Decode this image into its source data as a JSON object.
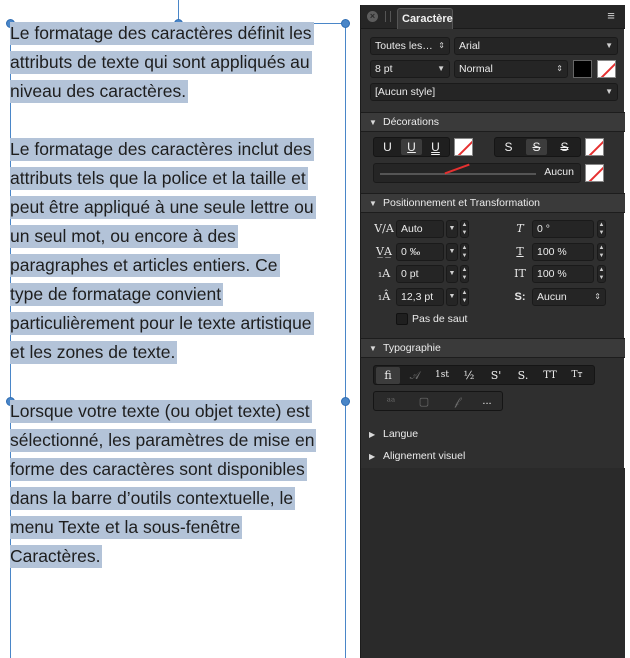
{
  "text_frame": {
    "paragraphs": [
      [
        "Le formatage des caractères définit les",
        "attributs de texte qui sont appliqués au",
        "niveau des caractères."
      ],
      [
        "Le formatage des caractères inclut des",
        "attributs tels que la police et la taille et",
        "peut être appliqué à une seule lettre ou",
        "un seul mot, ou encore à des",
        "paragraphes et articles entiers. Ce",
        "type de formatage convient",
        "particulièrement pour le texte artistique",
        "et les zones de texte."
      ],
      [
        "Lorsque votre texte (ou objet texte) est",
        "sélectionné, les paramètres de mise en",
        "forme des caractères sont disponibles",
        "dans la barre d’outils contextuelle, le",
        "menu Texte et la sous-fenêtre",
        "Caractères."
      ]
    ]
  },
  "panel": {
    "tab_label": "Caractère",
    "close_glyph": "×",
    "menu_glyph": "≡",
    "font": {
      "collection": "Toutes les…",
      "family": "Arial",
      "size": "8 pt",
      "style": "Normal",
      "text_style": "[Aucun style]"
    },
    "decorations": {
      "title": "Décorations",
      "underline_buttons": [
        "U",
        "U",
        "U"
      ],
      "strike_buttons": [
        "S",
        "S",
        "S"
      ],
      "slider_value": "Aucun"
    },
    "positioning": {
      "title": "Positionnement et Transformation",
      "kerning": "Auto",
      "tracking": "0 ‰",
      "baseline": "0 pt",
      "leading": "12,3 pt",
      "shear": "0 °",
      "scale_horizontal": "100 %",
      "scale_vertical": "100 %",
      "alignment": "Aucun",
      "no_break_label": "Pas de saut"
    },
    "typography": {
      "title": "Typographie",
      "row1": [
        "ﬁ",
        "𝒜",
        "1st",
        "½",
        "S'",
        "S.",
        "TT",
        "Tт"
      ],
      "row2": [
        "ᵃᵃ",
        "▢",
        "𝒻",
        "..."
      ]
    },
    "language": {
      "title": "Langue"
    },
    "visual_alignment": {
      "title": "Alignement visuel"
    }
  },
  "colors": {
    "selection": "#b3c3d8",
    "frame": "#4a86c8",
    "panel_bg": "#2f2f2f",
    "none_swatch_line": "#e53030"
  }
}
